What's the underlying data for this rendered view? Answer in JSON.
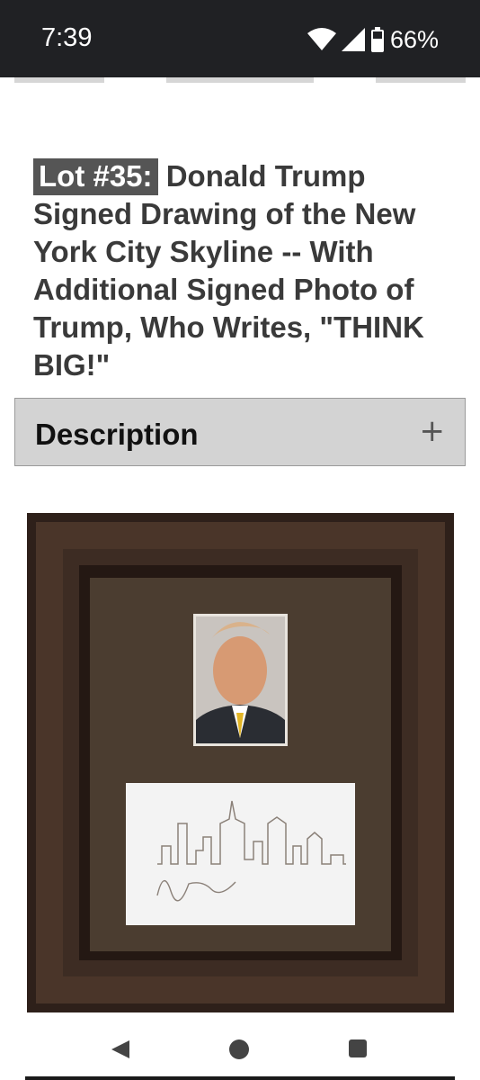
{
  "status_bar": {
    "time": "7:39",
    "battery": "66%",
    "icons": [
      "wifi-icon",
      "cell-signal-icon",
      "battery-icon"
    ]
  },
  "lot": {
    "number_label": "Lot #35:",
    "title": "Donald Trump Signed Drawing of the New York City Skyline -- With Additional Signed Photo of Trump, Who Writes, \"THINK BIG!\""
  },
  "accordion": {
    "label": "Description",
    "toggle_icon": "plus-icon"
  },
  "image": {
    "subject": "framed signed photo and signed skyline drawing"
  },
  "nav_bar": {
    "icons": [
      "back-icon",
      "home-icon",
      "recents-icon"
    ]
  },
  "colors": {
    "status_bar_bg": "#202124",
    "badge_bg": "#555555",
    "title_text": "#3a3a3a",
    "accordion_bg": "#d3d3d3",
    "frame_brown": "#3b2a22"
  }
}
